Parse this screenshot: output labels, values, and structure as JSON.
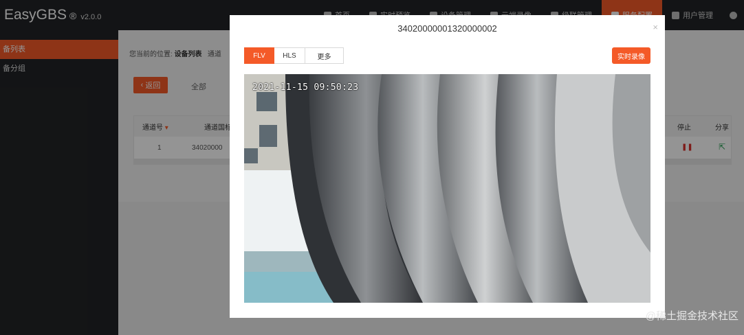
{
  "app": {
    "name": "EasyGBS",
    "reg_mark": "®",
    "version": "v2.0.0"
  },
  "header": {
    "nav": [
      {
        "label": "首页",
        "icon": "home-icon"
      },
      {
        "label": "实时预览",
        "icon": "video-icon"
      },
      {
        "label": "设备管理",
        "icon": "device-icon"
      },
      {
        "label": "云端录像",
        "icon": "cloud-icon"
      },
      {
        "label": "级联管理",
        "icon": "cascade-icon"
      },
      {
        "label": "服务配置",
        "icon": "gear-icon",
        "active": true
      },
      {
        "label": "用户管理",
        "icon": "user-icon"
      },
      {
        "label": "",
        "icon": "settings-icon"
      }
    ]
  },
  "sidebar": {
    "items": [
      {
        "label": "备列表",
        "active": true
      },
      {
        "label": "备分组",
        "active": false
      }
    ]
  },
  "main": {
    "breadcrumb_prefix": "您当前的位置:",
    "breadcrumb_current": "设备列表",
    "breadcrumb_next": "通道",
    "back_label": "返回",
    "filter_label": "全部",
    "table": {
      "headers": [
        "通道号",
        "通道国标",
        "停止",
        "分享"
      ],
      "rows": [
        {
          "channel": "1",
          "gb_id": "34020000"
        }
      ]
    }
  },
  "modal": {
    "title": "34020000001320000002",
    "close_icon": "×",
    "tabs": [
      {
        "label": "FLV",
        "active": true
      },
      {
        "label": "HLS",
        "active": false
      },
      {
        "label": "更多",
        "active": false
      }
    ],
    "record_label": "实时录像",
    "video_timestamp": "2021-11-15 09:50:23"
  },
  "watermark": "@稀土掘金技术社区",
  "colors": {
    "accent": "#f45a28",
    "header_bg": "#222426",
    "stop_icon": "#d9302b",
    "share_icon": "#2aa055"
  }
}
